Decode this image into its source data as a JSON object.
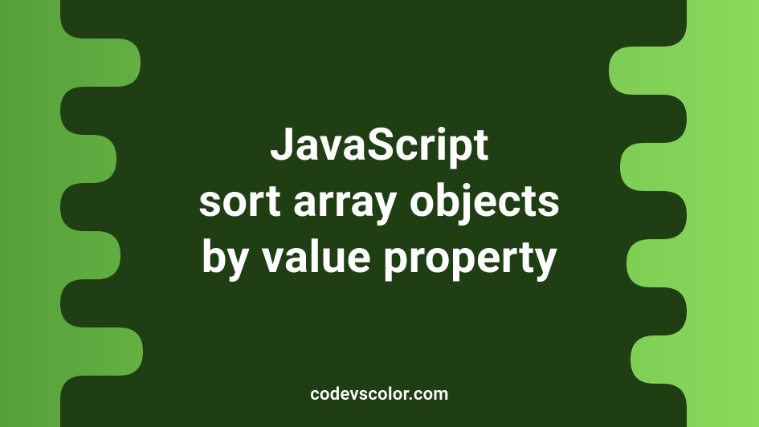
{
  "title": {
    "line1": "JavaScript",
    "line2": "sort array objects",
    "line3": "by value property"
  },
  "credit": "codevscolor.com",
  "colors": {
    "blob": "#1f3e14",
    "text": "#ffffff",
    "gradient_start": "#56a03a",
    "gradient_end": "#8ad95c"
  }
}
